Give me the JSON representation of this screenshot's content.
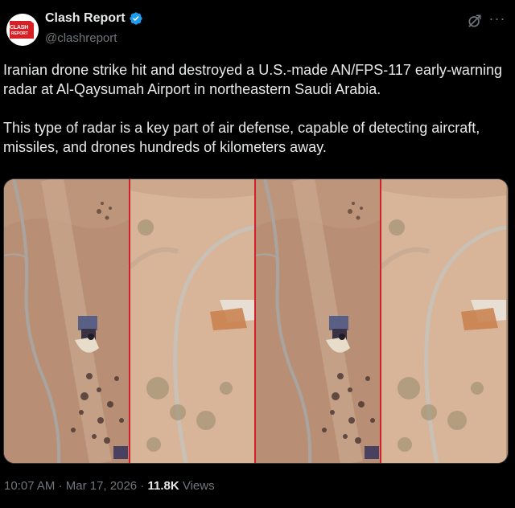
{
  "author": {
    "name": "Clash Report",
    "handle": "@clashreport",
    "avatar_line1": "CLASH",
    "avatar_line2": "REPORT"
  },
  "post": {
    "paragraphs": [
      "Iranian drone strike hit and destroyed a U.S.-made AN/FPS-117 early-warning radar at Al-Qaysumah Airport in northeastern Saudi Arabia.",
      "This type of radar is a key part of air defense, capable of detecting aircraft, missiles, and drones hundreds of kilometers away."
    ]
  },
  "meta": {
    "time": "10:07 AM",
    "separator": "·",
    "date": "Mar 17, 2026",
    "views_count": "11.8K",
    "views_label": "Views"
  },
  "media": {
    "panel_count": 4,
    "divider_color": "#d0202a"
  },
  "icons": {
    "verified": "verified-badge-icon",
    "grok": "grok-icon",
    "more": "more-icon"
  },
  "colors": {
    "background": "#000000",
    "text": "#e7e9ea",
    "secondary": "#71767b",
    "verified": "#1d9bf0",
    "brand_red": "#d81f26"
  }
}
